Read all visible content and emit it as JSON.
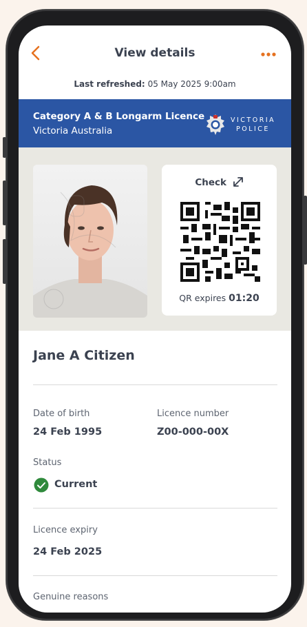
{
  "header": {
    "title": "View details",
    "back_icon": "chevron-left-icon",
    "more_icon": "more-horizontal-icon",
    "accent_color": "#e5711f"
  },
  "refresh": {
    "label": "Last refreshed:",
    "value": "05 May 2025 9:00am"
  },
  "banner": {
    "title": "Category A & B Longarm Licence",
    "subtitle": "Victoria Australia",
    "logo_line1": "VICTORIA",
    "logo_line2": "POLICE",
    "color": "#2b56a4"
  },
  "qr": {
    "check_label": "Check",
    "expires_label": "QR expires",
    "expires_time": "01:20"
  },
  "person": {
    "name": "Jane A Citizen"
  },
  "details": {
    "dob_label": "Date of birth",
    "dob_value": "24 Feb 1995",
    "licence_label": "Licence number",
    "licence_value": "Z00-000-00X",
    "status_label": "Status",
    "status_value": "Current",
    "status_color": "#2f8a3c",
    "expiry_label": "Licence expiry",
    "expiry_value": "24 Feb 2025",
    "reasons_label": "Genuine reasons"
  }
}
